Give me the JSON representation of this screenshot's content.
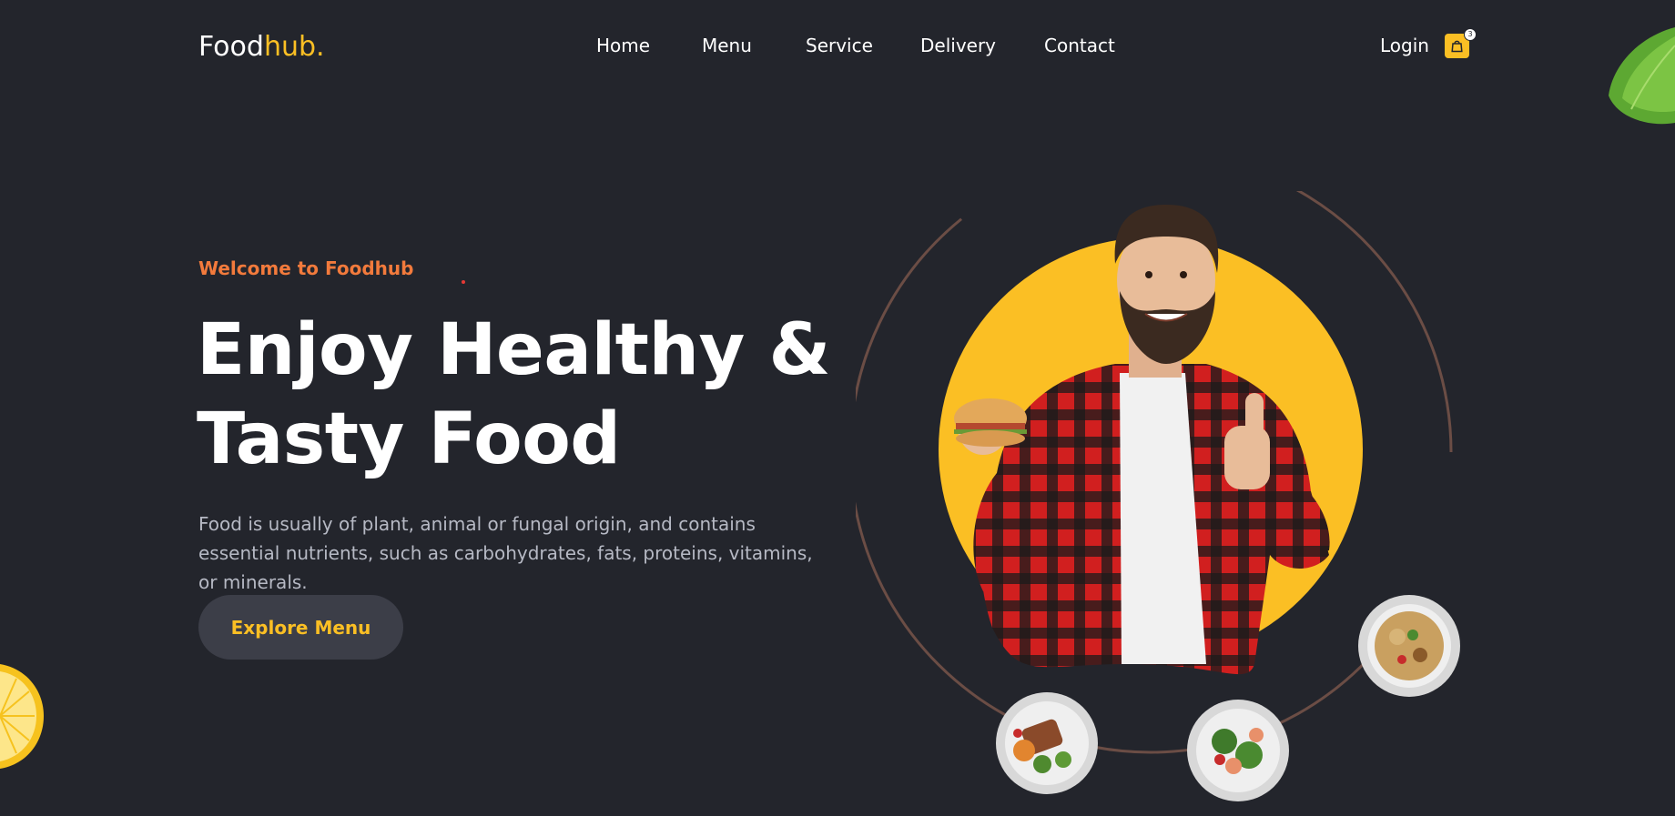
{
  "brand": {
    "name_part1": "Food",
    "name_part2": "hub."
  },
  "nav": {
    "items": [
      "Home",
      "Menu",
      "Service",
      "Delivery",
      "Contact"
    ],
    "login_label": "Login",
    "cart_count": "3"
  },
  "hero": {
    "kicker": "Welcome to Foodhub",
    "headline_line1": "Enjoy Healthy &",
    "headline_line2": "Tasty Food",
    "description": "Food is usually of plant, animal or fungal origin, and contains essential nutrients, such as carbohydrates, fats, proteins, vitamins, or minerals.",
    "cta_label": "Explore Menu"
  },
  "colors": {
    "background": "#23252c",
    "accent_yellow": "#fbbf24",
    "accent_orange": "#f27a3c",
    "button_bg": "#3c3e48",
    "muted_text": "#b6b9c4"
  },
  "icons": [
    "shopping-bag-icon",
    "lemon-slice",
    "lettuce-leaf",
    "food-plate"
  ]
}
